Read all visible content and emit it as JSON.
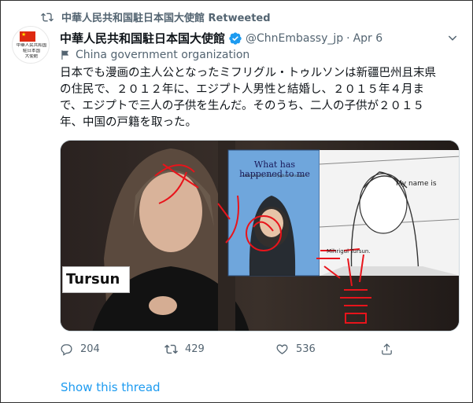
{
  "retweet": {
    "label": "中華人民共和国駐日本国大使館 Retweeted"
  },
  "account": {
    "name": "中華人民共和国駐日本国大使館",
    "handle": "@ChnEmbassy_jp",
    "separator": "·",
    "date": "Apr 6",
    "affiliation": "China government organization",
    "avatar_text": [
      "中華人民共和国",
      "駐日本国",
      "大使館"
    ]
  },
  "tweet": {
    "lines": [
      "日本でも漫画の主人公となったミフリグル・トゥルソンは新疆巴州且末県",
      "の住民で、２０１２年に、エジプト人男性と結婚し、２０１５年４月ま",
      "で、エジプトで三人の子供を生んだ。そのうち、二人の子供が２０１５",
      "年、中国の戸籍を取った。"
    ]
  },
  "media": {
    "label_tursun": "Tursun",
    "book_title": "What has happened to me",
    "book_subtitle": "~testimony of a Uyghur woman~",
    "bubble_text": "My name is",
    "manga_name": "Mihrigul Tursun.",
    "overlay_text": [
      "ウ",
      "ソ",
      "の",
      "証",
      "言"
    ]
  },
  "actions": {
    "replies": "204",
    "retweets": "429",
    "likes": "536"
  },
  "show_thread": "Show this thread",
  "colors": {
    "accent": "#1d9bf0",
    "secondary": "#536471",
    "overlay_red": "#e8141b",
    "flag_red": "#de2910"
  }
}
